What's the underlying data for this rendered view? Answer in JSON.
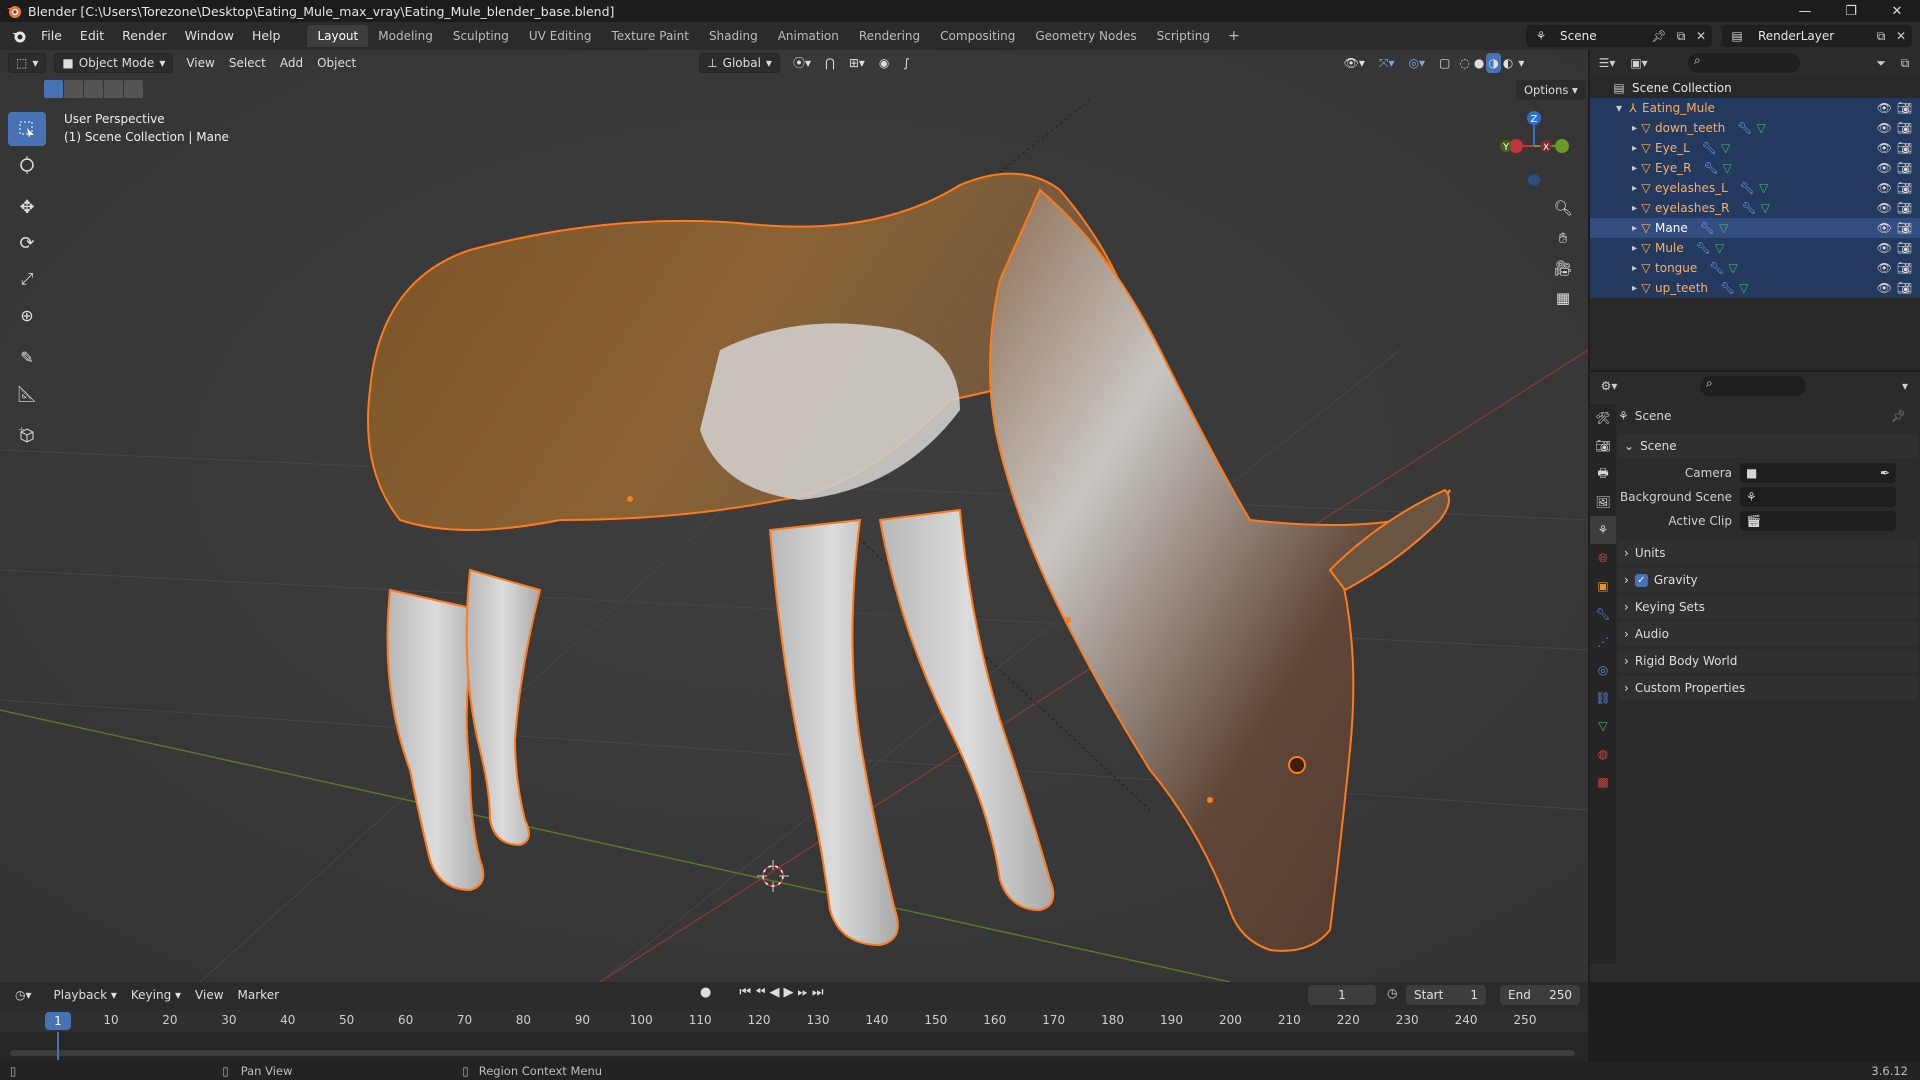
{
  "window": {
    "title": "Blender [C:\\Users\\Torezone\\Desktop\\Eating_Mule_max_vray\\Eating_Mule_blender_base.blend]",
    "minimize": "—",
    "maximize": "❐",
    "close": "✕"
  },
  "menu": {
    "items": [
      "File",
      "Edit",
      "Render",
      "Window",
      "Help"
    ]
  },
  "workspaces": {
    "tabs": [
      "Layout",
      "Modeling",
      "Sculpting",
      "UV Editing",
      "Texture Paint",
      "Shading",
      "Animation",
      "Rendering",
      "Compositing",
      "Geometry Nodes",
      "Scripting"
    ],
    "active": "Layout",
    "add": "+"
  },
  "scene_selector": {
    "label": "Scene"
  },
  "layer_selector": {
    "label": "RenderLayer"
  },
  "viewport": {
    "mode": "Object Mode",
    "menus": [
      "View",
      "Select",
      "Add",
      "Object"
    ],
    "transform_orientation": "Global",
    "options_label": "Options",
    "info_line1": "User Perspective",
    "info_line2": "(1) Scene Collection | Mane",
    "gizmo_axes": [
      "Z",
      "Y",
      "X"
    ]
  },
  "outliner": {
    "root": "Scene Collection",
    "collection": "Eating_Mule",
    "objects": [
      "down_teeth",
      "Eye_L",
      "Eye_R",
      "eyelashes_L",
      "eyelashes_R",
      "Mane",
      "Mule",
      "tongue",
      "up_teeth"
    ],
    "active_object": "Mane"
  },
  "properties": {
    "context_title": "Scene",
    "panel_scene": "Scene",
    "camera_label": "Camera",
    "background_scene_label": "Background Scene",
    "active_clip_label": "Active Clip",
    "panels": [
      "Units",
      "Gravity",
      "Keying Sets",
      "Audio",
      "Rigid Body World",
      "Custom Properties"
    ],
    "gravity_checked": true
  },
  "timeline": {
    "menus": [
      "Playback",
      "Keying",
      "View",
      "Marker"
    ],
    "current_frame": "1",
    "start_label": "Start",
    "start_value": "1",
    "end_label": "End",
    "end_value": "250",
    "ruler_labels": [
      "10",
      "20",
      "30",
      "40",
      "50",
      "60",
      "70",
      "80",
      "90",
      "100",
      "110",
      "120",
      "130",
      "140",
      "150",
      "160",
      "170",
      "180",
      "190",
      "200",
      "210",
      "220",
      "230",
      "240",
      "250"
    ],
    "playhead_label": "1"
  },
  "statusbar": {
    "pan_view": "Pan View",
    "region_context_menu": "Region Context Menu",
    "version": "3.6.12"
  },
  "colors": {
    "accent": "#4772b3",
    "selection_outline": "#ff7a1a",
    "object_name": "#ffae5b",
    "x_axis": "#c4343f",
    "y_axis": "#6a9a24",
    "z_axis": "#2f6bd1"
  }
}
